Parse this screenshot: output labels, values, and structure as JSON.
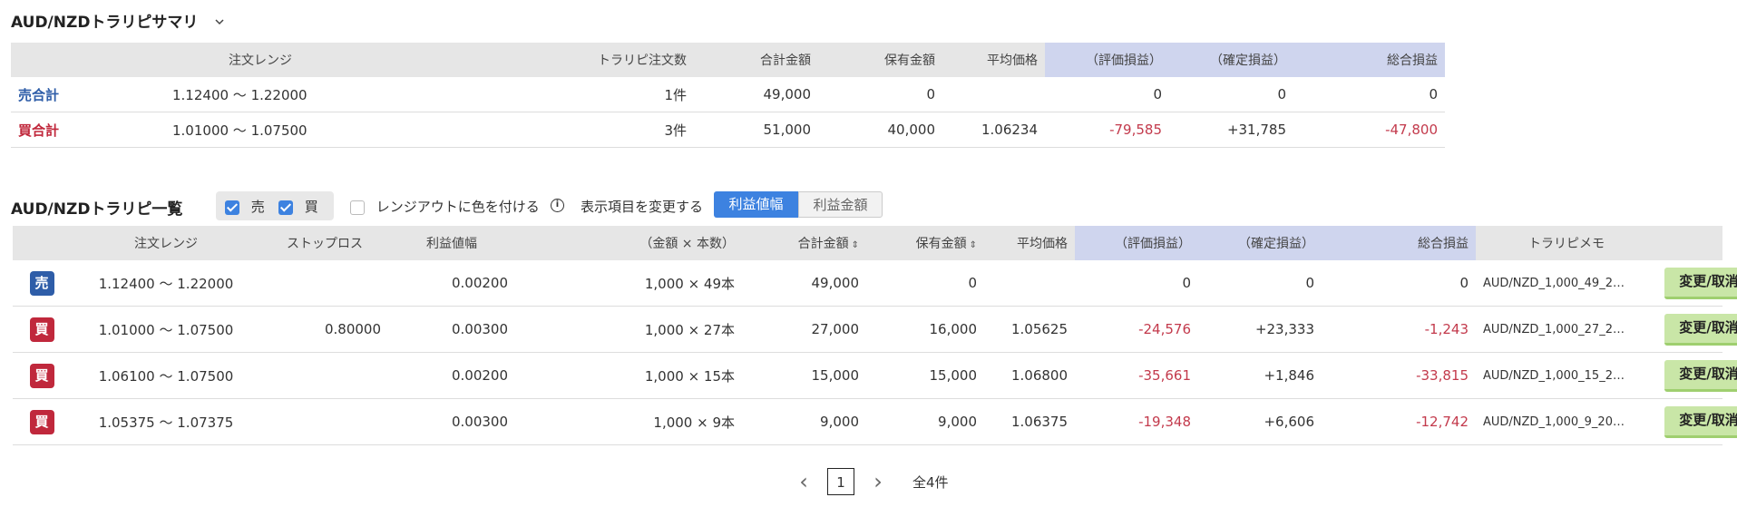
{
  "summary": {
    "title": "AUD/NZDトラリピサマリ",
    "toggle_icon": "chevron-down-icon",
    "headers": [
      "注文レンジ",
      "トラリピ注文数",
      "合計金額",
      "保有金額",
      "平均価格",
      "（評価損益）",
      "（確定損益）",
      "総合損益"
    ],
    "rows": [
      {
        "label": "売合計",
        "range": "1.12400 〜 1.22000",
        "count": "1件",
        "total": "49,000",
        "holding": "0",
        "avg": "",
        "eval": "0",
        "realized": "0",
        "overall": "0"
      },
      {
        "label": "買合計",
        "range": "1.01000 〜 1.07500",
        "count": "3件",
        "total": "51,000",
        "holding": "40,000",
        "avg": "1.06234",
        "eval": "-79,585",
        "realized": "+31,785",
        "overall": "-47,800"
      }
    ]
  },
  "list": {
    "title": "AUD/NZDトラリピ一覧",
    "filter_sell_label": "売",
    "filter_buy_label": "買",
    "range_out_label": "レンジアウトに色を付ける",
    "info_icon": "info-icon",
    "change_display_label": "表示項目を変更する",
    "toggle_profit_width": "利益値幅",
    "toggle_profit_amount": "利益金額",
    "headers": [
      "注文レンジ",
      "ストップロス",
      "利益値幅",
      "（金額 × 本数）",
      "合計金額",
      "保有金額",
      "平均価格",
      "（評価損益）",
      "（確定損益）",
      "総合損益",
      "トラリピメモ"
    ],
    "sort_icon": "sort-icon",
    "rows": [
      {
        "side": "売",
        "range": "1.12400 〜 1.22000",
        "stop": "",
        "width": "0.00200",
        "qty": "1,000 × 49本",
        "total": "49,000",
        "holding": "0",
        "avg": "",
        "eval": "0",
        "realized": "0",
        "overall": "0",
        "memo": "AUD/NZD_1,000_49_2…",
        "action": "変更/取消"
      },
      {
        "side": "買",
        "range": "1.01000 〜 1.07500",
        "stop": "0.80000",
        "width": "0.00300",
        "qty": "1,000 × 27本",
        "total": "27,000",
        "holding": "16,000",
        "avg": "1.05625",
        "eval": "-24,576",
        "realized": "+23,333",
        "overall": "-1,243",
        "memo": "AUD/NZD_1,000_27_2…",
        "action": "変更/取消"
      },
      {
        "side": "買",
        "range": "1.06100 〜 1.07500",
        "stop": "",
        "width": "0.00200",
        "qty": "1,000 × 15本",
        "total": "15,000",
        "holding": "15,000",
        "avg": "1.06800",
        "eval": "-35,661",
        "realized": "+1,846",
        "overall": "-33,815",
        "memo": "AUD/NZD_1,000_15_2…",
        "action": "変更/取消"
      },
      {
        "side": "買",
        "range": "1.05375 〜 1.07375",
        "stop": "",
        "width": "0.00300",
        "qty": "1,000 × 9本",
        "total": "9,000",
        "holding": "9,000",
        "avg": "1.06375",
        "eval": "-19,348",
        "realized": "+6,606",
        "overall": "-12,742",
        "memo": "AUD/NZD_1,000_9_20…",
        "action": "変更/取消"
      }
    ]
  },
  "pagination": {
    "prev": "‹",
    "page": "1",
    "next": "›",
    "total": "全4件"
  },
  "colors": {
    "sell": "#2e5da8",
    "buy": "#c0283c",
    "negative": "#c33a4c",
    "accent": "#3d82e0",
    "button": "#c9e6a7"
  }
}
